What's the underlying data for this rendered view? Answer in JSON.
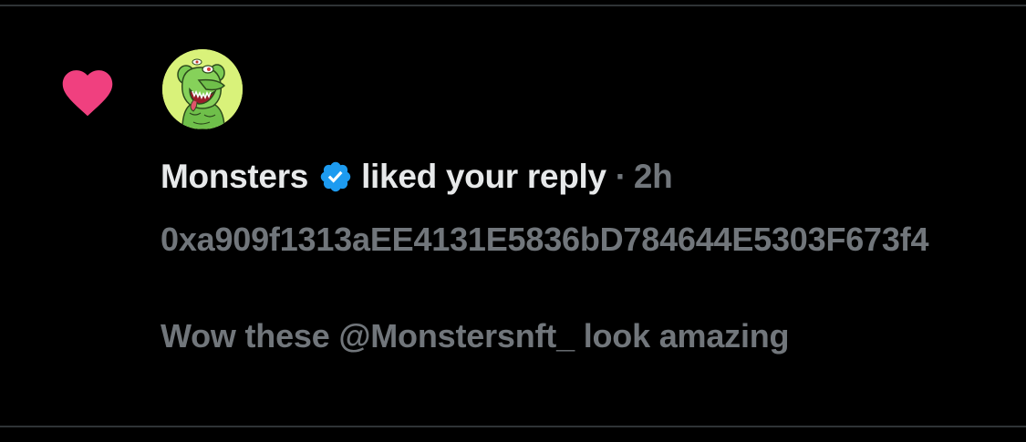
{
  "notification": {
    "user_name": "Monsters",
    "verified": true,
    "action": "liked your reply",
    "separator": "·",
    "timestamp": "2h",
    "reply_text": "0xa909f1313aEE4131E5836bD784644E5303F673f4\n\nWow these @Monstersnft_ look amazing",
    "icon": "heart-icon",
    "avatar": "monster-avatar"
  },
  "colors": {
    "background": "#000000",
    "heart": "#f91880",
    "verified_badge": "#1d9bf0",
    "primary_text": "#e7e9ea",
    "secondary_text": "#71767b",
    "divider": "#2f3336"
  }
}
